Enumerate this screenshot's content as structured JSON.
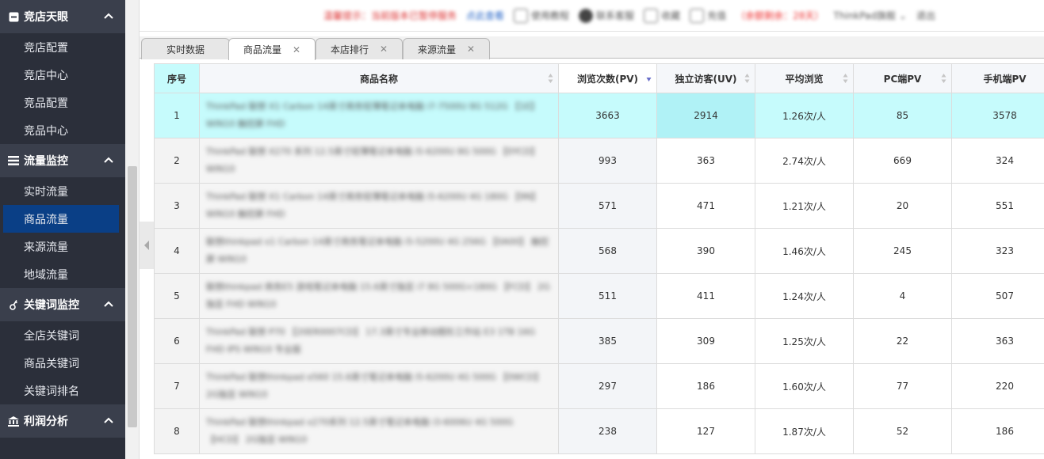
{
  "sidebar": {
    "sections": [
      {
        "label": "竞店天眼",
        "icon": "minus-square-icon",
        "items": [
          "竞店配置",
          "竞店中心",
          "竞品配置",
          "竞品中心"
        ]
      },
      {
        "label": "流量监控",
        "icon": "list-icon",
        "items": [
          "实时流量",
          "商品流量",
          "来源流量",
          "地域流量"
        ]
      },
      {
        "label": "关键词监控",
        "icon": "key-icon",
        "items": [
          "全店关键词",
          "商品关键词",
          "关键词排名"
        ]
      },
      {
        "label": "利润分析",
        "icon": "bank-icon",
        "items": []
      }
    ],
    "active_item": "商品流量"
  },
  "topbar": {
    "notice": "温馨提示：当前版本已暂停服务",
    "link": "点此查看",
    "items": [
      "使用教程",
      "联系客服",
      "收藏",
      "充值",
      "ThinkPad旗舰"
    ],
    "red_text": "（余额剩余：28天）",
    "user": "退出"
  },
  "tabs": [
    {
      "label": "实时数据",
      "closable": false
    },
    {
      "label": "商品流量",
      "closable": true
    },
    {
      "label": "本店排行",
      "closable": true
    },
    {
      "label": "来源流量",
      "closable": true
    }
  ],
  "table": {
    "columns": [
      "序号",
      "商品名称",
      "浏览次数(PV)",
      "独立访客(UV)",
      "平均浏览",
      "PC端PV",
      "手机端PV"
    ],
    "rows": [
      {
        "idx": "1",
        "name": "ThinkPad 联想 X1 Carbon 14英寸商务轻薄笔记本电脑 i7-7500U 8G 512G 【1E】 WIN10 触控屏 FHD",
        "pv": "3663",
        "uv": "2914",
        "avg": "1.26次/人",
        "pc": "85",
        "mobile": "3578"
      },
      {
        "idx": "2",
        "name": "ThinkPad 联想 X270 系列 12.5英寸轻薄笔记本电脑 i5-6200U 8G 500G 【0YCD】 WIN10",
        "pv": "993",
        "uv": "363",
        "avg": "2.74次/人",
        "pc": "669",
        "mobile": "324"
      },
      {
        "idx": "3",
        "name": "ThinkPad 联想 X1 Carbon 14英寸商务轻薄笔记本电脑 i5-6200U 4G 180G 【9N】 WIN10 触控屏 FHD",
        "pv": "571",
        "uv": "471",
        "avg": "1.21次/人",
        "pc": "20",
        "mobile": "551"
      },
      {
        "idx": "4",
        "name": "联想thinkpad x1 Carbon 14英寸商务笔记本电脑 i5-5200U 4G 256G 【0A00】 触控屏 WIN10",
        "pv": "568",
        "uv": "390",
        "avg": "1.46次/人",
        "pc": "245",
        "mobile": "323"
      },
      {
        "idx": "5",
        "name": "联想thinkpad 商务E5 游戏笔记本电脑 15.6英寸独显 i7 8G 500G+180G 【FCD】 2G独显 FHD WIN10",
        "pv": "511",
        "uv": "411",
        "avg": "1.24次/人",
        "pc": "4",
        "mobile": "507"
      },
      {
        "idx": "6",
        "name": "ThinkPad 联想 P70 【20ER0007CD】 17.3英寸专业移动图形工作站 E3 1TB 16G FHD IPS WIN10 专业版",
        "pv": "385",
        "uv": "309",
        "avg": "1.25次/人",
        "pc": "22",
        "mobile": "363"
      },
      {
        "idx": "7",
        "name": "ThinkPad 联想thinkpad e560 15.6英寸笔记本电脑 i5-6200U 4G 500G 【0WCD】 2G独显 WIN10",
        "pv": "297",
        "uv": "186",
        "avg": "1.60次/人",
        "pc": "77",
        "mobile": "220"
      },
      {
        "idx": "8",
        "name": "ThinkPad 联想thinkpad x270系列 12.5英寸笔记本电脑 i3-6006U 4G 500G 【HCD】 2G独显 WIN10",
        "pv": "238",
        "uv": "127",
        "avg": "1.87次/人",
        "pc": "52",
        "mobile": "186"
      }
    ],
    "highlight_row": 0,
    "sorted_column": "浏览次数(PV)",
    "sort_direction": "desc",
    "highlight_color": "#c6fbfc"
  },
  "colors": {
    "sidebar_bg": "#2b2f3a",
    "section_bg": "#3a3f4c",
    "active_bg": "#0a3f86"
  }
}
